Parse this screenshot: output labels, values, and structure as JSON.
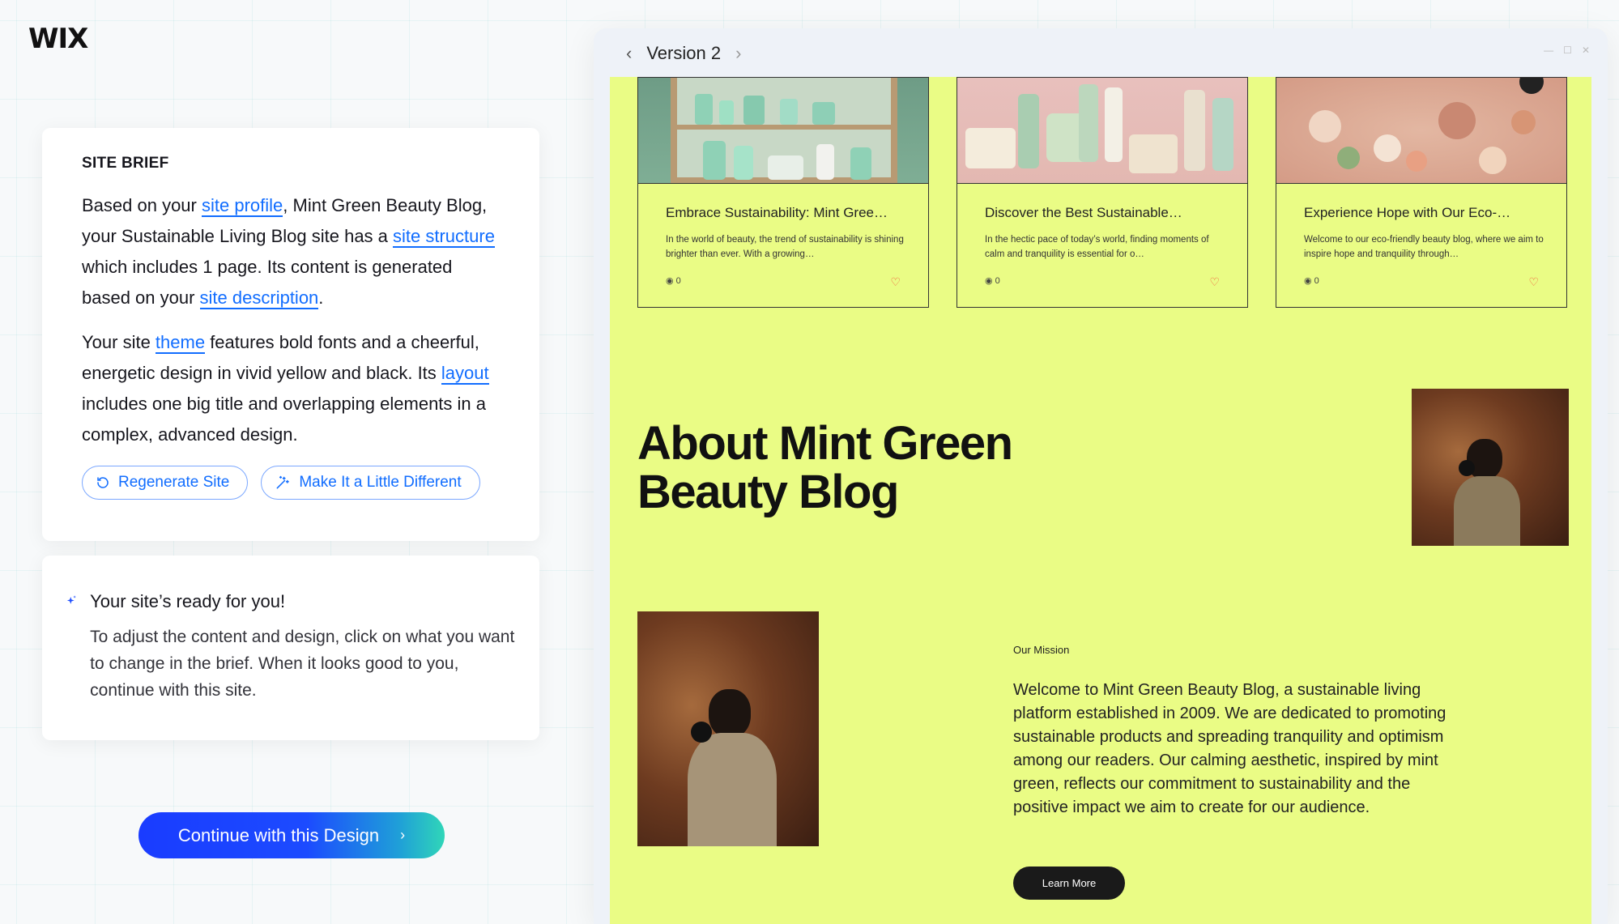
{
  "brand": {
    "logo": "WIX"
  },
  "brief": {
    "heading": "SITE BRIEF",
    "p1": {
      "t1": "Based on your ",
      "link1": "site profile",
      "t2": ", Mint Green Beauty Blog, your Sustainable Living Blog site has a ",
      "link2": "site structure",
      "t3": " which includes 1 page. Its content is generated based on your ",
      "link3": "site description",
      "t4": "."
    },
    "p2": {
      "t1": "Your site ",
      "link1": "theme",
      "t2": " features bold fonts and a cheerful, energetic design in vivid yellow and black. Its ",
      "link2": "layout",
      "t3": " includes one big title and overlapping elements in a complex, advanced design."
    },
    "regenerate_label": "Regenerate Site",
    "different_label": "Make It a Little Different"
  },
  "ready": {
    "title": "Your site’s ready for you!",
    "body": "To adjust the content and design, click on what you want to change in the brief. When it looks good to you, continue with this site."
  },
  "continue_label": "Continue with this Design",
  "preview": {
    "version_label": "Version 2",
    "posts": [
      {
        "title": "Embrace Sustainability: Mint Gree…",
        "excerpt": "In the world of beauty, the trend of sustainability is shining brighter than ever. With a growing…",
        "views": "0"
      },
      {
        "title": "Discover the Best Sustainable…",
        "excerpt": "In the hectic pace of today’s world, finding moments of calm and tranquility is essential for o…",
        "views": "0"
      },
      {
        "title": "Experience Hope with Our Eco-…",
        "excerpt": "Welcome to our eco-friendly beauty blog, where we aim to inspire hope and tranquility through…",
        "views": "0"
      }
    ],
    "about_title_line1": "About Mint Green",
    "about_title_line2": "Beauty Blog",
    "mission_label": "Our Mission",
    "mission_text": "Welcome to Mint Green Beauty Blog, a sustainable living platform established in 2009. We are dedicated to promoting sustainable products and spreading tranquility and optimism among our readers. Our calming aesthetic, inspired by mint green, reflects our commitment to sustainability and the positive impact we aim to create for our audience.",
    "learn_more_label": "Learn More"
  },
  "colors": {
    "accent": "#116dff",
    "site_background": "#eafc85",
    "heart": "#f25a3c"
  }
}
